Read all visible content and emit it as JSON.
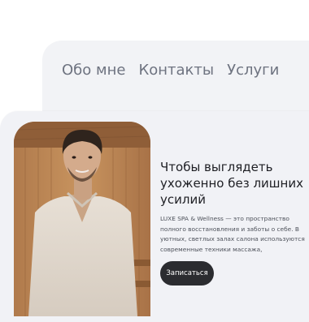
{
  "nav": {
    "items": [
      "Обо мне",
      "Контакты",
      "Услуги"
    ]
  },
  "hero": {
    "title_line1": "Чтобы выглядеть",
    "title_line2": "ухоженно без лишних",
    "title_line3": "усилий",
    "description_line1": "LUXE SPA & Wellness — это пространство",
    "description_line2": "полного восстановления и заботы о себе. В",
    "description_line3": "уютных, светлых залах салона используются",
    "description_line4": "современные техники массажа, профессион...",
    "cta_label": "Записаться",
    "photo_alt": "man in sauna"
  },
  "colors": {
    "page_bg": "#ffffff",
    "card_bg": "#f1f2f6",
    "nav_text": "#6e7380",
    "title_text": "#1e1f24",
    "button_bg": "#2b2c30",
    "button_text": "#ffffff"
  }
}
